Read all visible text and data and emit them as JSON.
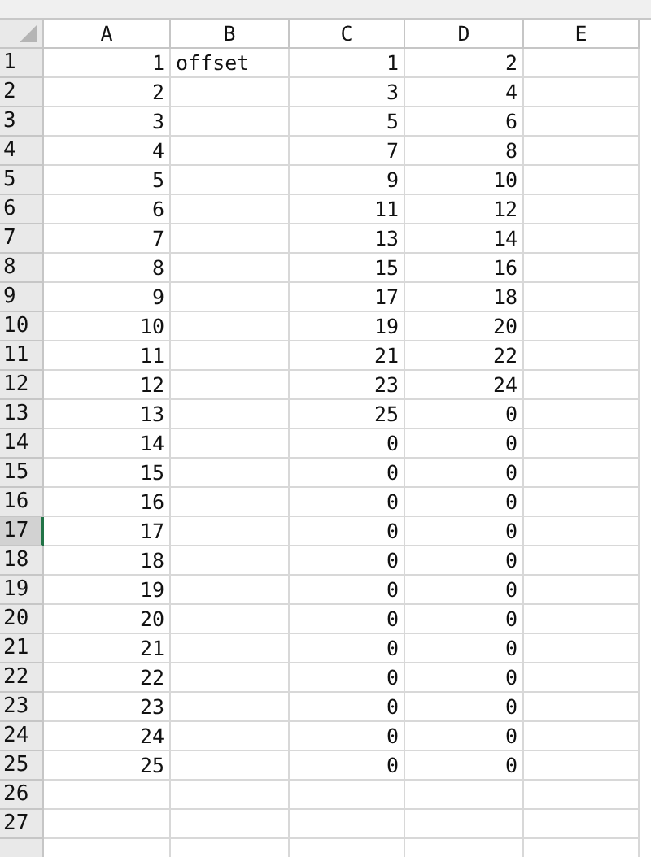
{
  "columns": [
    {
      "label": "A"
    },
    {
      "label": "B"
    },
    {
      "label": "C"
    },
    {
      "label": "D"
    },
    {
      "label": "E"
    }
  ],
  "rows": [
    {
      "number": "1",
      "selected": false,
      "cells": [
        {
          "kind": "number",
          "value": "1"
        },
        {
          "kind": "text",
          "value": "offset"
        },
        {
          "kind": "number",
          "value": "1"
        },
        {
          "kind": "number",
          "value": "2"
        },
        {
          "kind": "empty"
        }
      ]
    },
    {
      "number": "2",
      "selected": false,
      "cells": [
        {
          "kind": "number",
          "value": "2"
        },
        {
          "kind": "empty"
        },
        {
          "kind": "number",
          "value": "3"
        },
        {
          "kind": "number",
          "value": "4"
        },
        {
          "kind": "empty"
        }
      ]
    },
    {
      "number": "3",
      "selected": false,
      "cells": [
        {
          "kind": "number",
          "value": "3"
        },
        {
          "kind": "empty"
        },
        {
          "kind": "number",
          "value": "5"
        },
        {
          "kind": "number",
          "value": "6"
        },
        {
          "kind": "empty"
        }
      ]
    },
    {
      "number": "4",
      "selected": false,
      "cells": [
        {
          "kind": "number",
          "value": "4"
        },
        {
          "kind": "empty"
        },
        {
          "kind": "number",
          "value": "7"
        },
        {
          "kind": "number",
          "value": "8"
        },
        {
          "kind": "empty"
        }
      ]
    },
    {
      "number": "5",
      "selected": false,
      "cells": [
        {
          "kind": "number",
          "value": "5"
        },
        {
          "kind": "empty"
        },
        {
          "kind": "number",
          "value": "9"
        },
        {
          "kind": "number",
          "value": "10"
        },
        {
          "kind": "empty"
        }
      ]
    },
    {
      "number": "6",
      "selected": false,
      "cells": [
        {
          "kind": "number",
          "value": "6"
        },
        {
          "kind": "empty"
        },
        {
          "kind": "number",
          "value": "11"
        },
        {
          "kind": "number",
          "value": "12"
        },
        {
          "kind": "empty"
        }
      ]
    },
    {
      "number": "7",
      "selected": false,
      "cells": [
        {
          "kind": "number",
          "value": "7"
        },
        {
          "kind": "empty"
        },
        {
          "kind": "number",
          "value": "13"
        },
        {
          "kind": "number",
          "value": "14"
        },
        {
          "kind": "empty"
        }
      ]
    },
    {
      "number": "8",
      "selected": false,
      "cells": [
        {
          "kind": "number",
          "value": "8"
        },
        {
          "kind": "empty"
        },
        {
          "kind": "number",
          "value": "15"
        },
        {
          "kind": "number",
          "value": "16"
        },
        {
          "kind": "empty"
        }
      ]
    },
    {
      "number": "9",
      "selected": false,
      "cells": [
        {
          "kind": "number",
          "value": "9"
        },
        {
          "kind": "empty"
        },
        {
          "kind": "number",
          "value": "17"
        },
        {
          "kind": "number",
          "value": "18"
        },
        {
          "kind": "empty"
        }
      ]
    },
    {
      "number": "10",
      "selected": false,
      "cells": [
        {
          "kind": "number",
          "value": "10"
        },
        {
          "kind": "empty"
        },
        {
          "kind": "number",
          "value": "19"
        },
        {
          "kind": "number",
          "value": "20"
        },
        {
          "kind": "empty"
        }
      ]
    },
    {
      "number": "11",
      "selected": false,
      "cells": [
        {
          "kind": "number",
          "value": "11"
        },
        {
          "kind": "empty"
        },
        {
          "kind": "number",
          "value": "21"
        },
        {
          "kind": "number",
          "value": "22"
        },
        {
          "kind": "empty"
        }
      ]
    },
    {
      "number": "12",
      "selected": false,
      "cells": [
        {
          "kind": "number",
          "value": "12"
        },
        {
          "kind": "empty"
        },
        {
          "kind": "number",
          "value": "23"
        },
        {
          "kind": "number",
          "value": "24"
        },
        {
          "kind": "empty"
        }
      ]
    },
    {
      "number": "13",
      "selected": false,
      "cells": [
        {
          "kind": "number",
          "value": "13"
        },
        {
          "kind": "empty"
        },
        {
          "kind": "number",
          "value": "25"
        },
        {
          "kind": "number",
          "value": "0"
        },
        {
          "kind": "empty"
        }
      ]
    },
    {
      "number": "14",
      "selected": false,
      "cells": [
        {
          "kind": "number",
          "value": "14"
        },
        {
          "kind": "empty"
        },
        {
          "kind": "number",
          "value": "0"
        },
        {
          "kind": "number",
          "value": "0"
        },
        {
          "kind": "empty"
        }
      ]
    },
    {
      "number": "15",
      "selected": false,
      "cells": [
        {
          "kind": "number",
          "value": "15"
        },
        {
          "kind": "empty"
        },
        {
          "kind": "number",
          "value": "0"
        },
        {
          "kind": "number",
          "value": "0"
        },
        {
          "kind": "empty"
        }
      ]
    },
    {
      "number": "16",
      "selected": false,
      "cells": [
        {
          "kind": "number",
          "value": "16"
        },
        {
          "kind": "empty"
        },
        {
          "kind": "number",
          "value": "0"
        },
        {
          "kind": "number",
          "value": "0"
        },
        {
          "kind": "empty"
        }
      ]
    },
    {
      "number": "17",
      "selected": true,
      "cells": [
        {
          "kind": "number",
          "value": "17"
        },
        {
          "kind": "empty"
        },
        {
          "kind": "number",
          "value": "0"
        },
        {
          "kind": "number",
          "value": "0"
        },
        {
          "kind": "empty"
        }
      ]
    },
    {
      "number": "18",
      "selected": false,
      "cells": [
        {
          "kind": "number",
          "value": "18"
        },
        {
          "kind": "empty"
        },
        {
          "kind": "number",
          "value": "0"
        },
        {
          "kind": "number",
          "value": "0"
        },
        {
          "kind": "empty"
        }
      ]
    },
    {
      "number": "19",
      "selected": false,
      "cells": [
        {
          "kind": "number",
          "value": "19"
        },
        {
          "kind": "empty"
        },
        {
          "kind": "number",
          "value": "0"
        },
        {
          "kind": "number",
          "value": "0"
        },
        {
          "kind": "empty"
        }
      ]
    },
    {
      "number": "20",
      "selected": false,
      "cells": [
        {
          "kind": "number",
          "value": "20"
        },
        {
          "kind": "empty"
        },
        {
          "kind": "number",
          "value": "0"
        },
        {
          "kind": "number",
          "value": "0"
        },
        {
          "kind": "empty"
        }
      ]
    },
    {
      "number": "21",
      "selected": false,
      "cells": [
        {
          "kind": "number",
          "value": "21"
        },
        {
          "kind": "empty"
        },
        {
          "kind": "number",
          "value": "0"
        },
        {
          "kind": "number",
          "value": "0"
        },
        {
          "kind": "empty"
        }
      ]
    },
    {
      "number": "22",
      "selected": false,
      "cells": [
        {
          "kind": "number",
          "value": "22"
        },
        {
          "kind": "empty"
        },
        {
          "kind": "number",
          "value": "0"
        },
        {
          "kind": "number",
          "value": "0"
        },
        {
          "kind": "empty"
        }
      ]
    },
    {
      "number": "23",
      "selected": false,
      "cells": [
        {
          "kind": "number",
          "value": "23"
        },
        {
          "kind": "empty"
        },
        {
          "kind": "number",
          "value": "0"
        },
        {
          "kind": "number",
          "value": "0"
        },
        {
          "kind": "empty"
        }
      ]
    },
    {
      "number": "24",
      "selected": false,
      "cells": [
        {
          "kind": "number",
          "value": "24"
        },
        {
          "kind": "empty"
        },
        {
          "kind": "number",
          "value": "0"
        },
        {
          "kind": "number",
          "value": "0"
        },
        {
          "kind": "empty"
        }
      ]
    },
    {
      "number": "25",
      "selected": false,
      "cells": [
        {
          "kind": "number",
          "value": "25"
        },
        {
          "kind": "empty"
        },
        {
          "kind": "number",
          "value": "0"
        },
        {
          "kind": "number",
          "value": "0"
        },
        {
          "kind": "empty"
        }
      ]
    },
    {
      "number": "26",
      "selected": false,
      "cells": [
        {
          "kind": "empty"
        },
        {
          "kind": "empty"
        },
        {
          "kind": "empty"
        },
        {
          "kind": "empty"
        },
        {
          "kind": "empty"
        }
      ]
    },
    {
      "number": "27",
      "selected": false,
      "cells": [
        {
          "kind": "empty"
        },
        {
          "kind": "empty"
        },
        {
          "kind": "empty"
        },
        {
          "kind": "empty"
        },
        {
          "kind": "empty"
        }
      ]
    }
  ]
}
